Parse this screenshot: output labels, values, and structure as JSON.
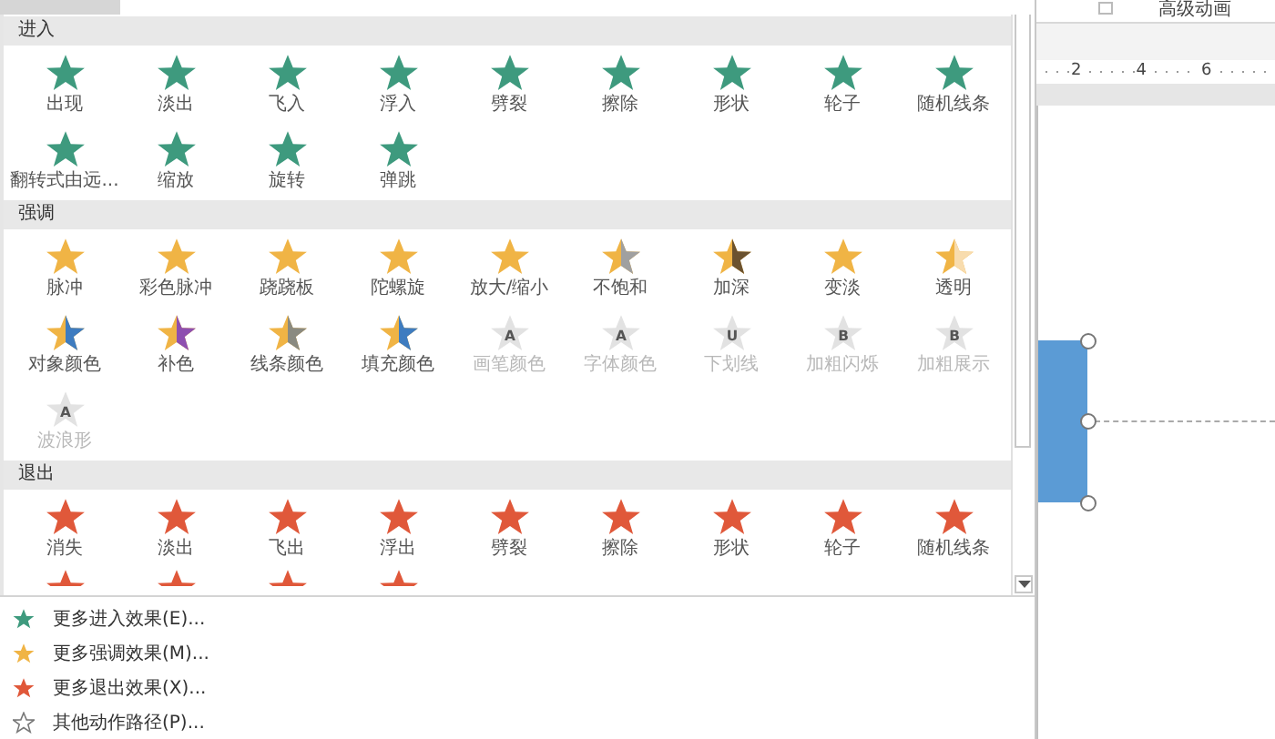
{
  "sections": [
    {
      "kind": "entrance",
      "title": "进入",
      "items": [
        {
          "label": "出现",
          "disabled": false
        },
        {
          "label": "淡出",
          "disabled": false
        },
        {
          "label": "飞入",
          "disabled": false
        },
        {
          "label": "浮入",
          "disabled": false
        },
        {
          "label": "劈裂",
          "disabled": false
        },
        {
          "label": "擦除",
          "disabled": false
        },
        {
          "label": "形状",
          "disabled": false
        },
        {
          "label": "轮子",
          "disabled": false
        },
        {
          "label": "随机线条",
          "disabled": false
        },
        {
          "label": "翻转式由远...",
          "disabled": false
        },
        {
          "label": "缩放",
          "disabled": false
        },
        {
          "label": "旋转",
          "disabled": false
        },
        {
          "label": "弹跳",
          "disabled": false
        }
      ]
    },
    {
      "kind": "emphasis",
      "title": "强调",
      "items": [
        {
          "label": "脉冲",
          "disabled": false
        },
        {
          "label": "彩色脉冲",
          "disabled": false
        },
        {
          "label": "跷跷板",
          "disabled": false
        },
        {
          "label": "陀螺旋",
          "disabled": false
        },
        {
          "label": "放大/缩小",
          "disabled": false
        },
        {
          "label": "不饱和",
          "disabled": false,
          "color": "#a0a0a0"
        },
        {
          "label": "加深",
          "disabled": false,
          "color": "#6b5230"
        },
        {
          "label": "变淡",
          "disabled": false
        },
        {
          "label": "透明",
          "disabled": false,
          "color": "#f8dcae"
        },
        {
          "label": "对象颜色",
          "disabled": false,
          "color": "#3e7cc0"
        },
        {
          "label": "补色",
          "disabled": false,
          "color": "#8e4fb0"
        },
        {
          "label": "线条颜色",
          "disabled": false,
          "color": "#8a8a80"
        },
        {
          "label": "填充颜色",
          "disabled": false,
          "color": "#3e7cc0"
        },
        {
          "label": "画笔颜色",
          "disabled": true,
          "glyph": "A"
        },
        {
          "label": "字体颜色",
          "disabled": true,
          "glyph": "A"
        },
        {
          "label": "下划线",
          "disabled": true,
          "glyph": "U"
        },
        {
          "label": "加粗闪烁",
          "disabled": true,
          "glyph": "B"
        },
        {
          "label": "加粗展示",
          "disabled": true,
          "glyph": "B"
        },
        {
          "label": "波浪形",
          "disabled": true,
          "glyph": "A"
        }
      ]
    },
    {
      "kind": "exit",
      "title": "退出",
      "items": [
        {
          "label": "消失",
          "disabled": false
        },
        {
          "label": "淡出",
          "disabled": false
        },
        {
          "label": "飞出",
          "disabled": false
        },
        {
          "label": "浮出",
          "disabled": false
        },
        {
          "label": "劈裂",
          "disabled": false
        },
        {
          "label": "擦除",
          "disabled": false
        },
        {
          "label": "形状",
          "disabled": false
        },
        {
          "label": "轮子",
          "disabled": false
        },
        {
          "label": "随机线条",
          "disabled": false
        }
      ],
      "partial_items": [
        {
          "kind": "effect"
        },
        {
          "kind": "effect"
        },
        {
          "kind": "effect"
        },
        {
          "kind": "effect"
        }
      ]
    }
  ],
  "menu": [
    {
      "kind": "entrance",
      "label": "更多进入效果(E)..."
    },
    {
      "kind": "emphasis",
      "label": "更多强调效果(M)..."
    },
    {
      "kind": "exit",
      "label": "更多退出效果(X)..."
    },
    {
      "kind": "path",
      "label": "其他动作路径(P)..."
    }
  ],
  "ribbon": {
    "group": "高级动画"
  },
  "ruler": [
    "2",
    "4",
    "6"
  ]
}
